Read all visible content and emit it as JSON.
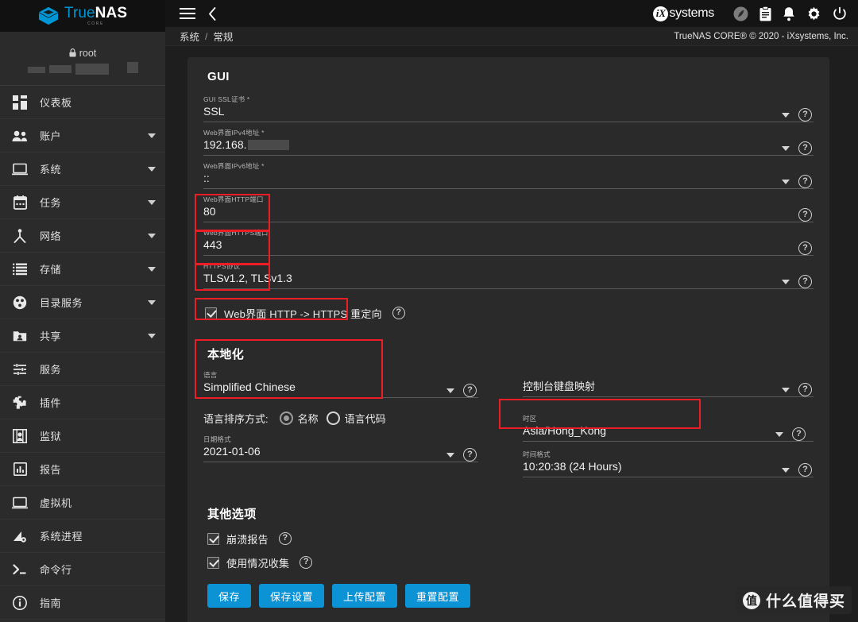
{
  "brand": {
    "name_blue": "True",
    "name_white": "NAS",
    "sub": "CORE"
  },
  "sidebar": {
    "user": {
      "name": "root",
      "lock_icon": "lock-icon"
    },
    "items": [
      {
        "label": "仪表板",
        "icon": "dashboard-icon",
        "expandable": false
      },
      {
        "label": "账户",
        "icon": "accounts-icon",
        "expandable": true
      },
      {
        "label": "系统",
        "icon": "system-icon",
        "expandable": true
      },
      {
        "label": "任务",
        "icon": "tasks-calendar-icon",
        "expandable": true
      },
      {
        "label": "网络",
        "icon": "network-icon",
        "expandable": true
      },
      {
        "label": "存储",
        "icon": "storage-icon",
        "expandable": true
      },
      {
        "label": "目录服务",
        "icon": "directory-services-icon",
        "expandable": true
      },
      {
        "label": "共享",
        "icon": "sharing-icon",
        "expandable": true
      },
      {
        "label": "服务",
        "icon": "services-sliders-icon",
        "expandable": false
      },
      {
        "label": "插件",
        "icon": "plugins-puzzle-icon",
        "expandable": false
      },
      {
        "label": "监狱",
        "icon": "jails-icon",
        "expandable": false
      },
      {
        "label": "报告",
        "icon": "reporting-chart-icon",
        "expandable": false
      },
      {
        "label": "虚拟机",
        "icon": "virtual-machines-icon",
        "expandable": false
      },
      {
        "label": "系统进程",
        "icon": "system-processes-icon",
        "expandable": false
      },
      {
        "label": "命令行",
        "icon": "shell-prompt-icon",
        "expandable": false
      },
      {
        "label": "指南",
        "icon": "guide-info-icon",
        "expandable": false
      }
    ]
  },
  "topbar": {
    "menu_icon": "hamburger-menu-icon",
    "back_icon": "chevron-left-icon",
    "ix_badge": "iX",
    "ix_word": "systems",
    "icons": [
      {
        "name": "resilver-status-icon"
      },
      {
        "name": "task-manager-clipboard-icon"
      },
      {
        "name": "alerts-bell-icon"
      },
      {
        "name": "settings-gear-icon"
      },
      {
        "name": "power-icon"
      }
    ]
  },
  "breadcrumb": {
    "parent": "系统",
    "separator": "/",
    "current": "常规"
  },
  "copyright": "TrueNAS CORE® © 2020 - iXsystems, Inc.",
  "gui": {
    "title": "GUI",
    "fields": [
      {
        "label": "GUI SSL证书 *",
        "value": "SSL",
        "dropdown": true,
        "help": true
      },
      {
        "label": "Web界面IPv4地址 *",
        "value": "192.168.",
        "redacted": true,
        "dropdown": true,
        "help": true
      },
      {
        "label": "Web界面IPv6地址 *",
        "value": "::",
        "dropdown": true,
        "help": true
      },
      {
        "label": "Web界面HTTP端口",
        "value": "80",
        "dropdown": false,
        "help": true
      },
      {
        "label": "Web界面HTTPS端口",
        "value": "443",
        "dropdown": false,
        "help": true
      },
      {
        "label": "HTTPS协议",
        "value": "TLSv1.2, TLSv1.3",
        "dropdown": true,
        "help": true
      }
    ],
    "redirect_checkbox": {
      "label": "Web界面 HTTP -> HTTPS 重定向",
      "checked": true,
      "help": true
    }
  },
  "localization": {
    "title": "本地化",
    "language": {
      "label": "语言",
      "value": "Simplified Chinese"
    },
    "keyboard_map": {
      "label": "控制台键盘映射",
      "value": ""
    },
    "sort_row": {
      "label": "语言排序方式:",
      "options": [
        {
          "text": "名称",
          "selected": true
        },
        {
          "text": "语言代码",
          "selected": false
        }
      ]
    },
    "timezone": {
      "label": "时区",
      "value": "Asia/Hong_Kong"
    },
    "date_format": {
      "label": "日期格式",
      "value": "2021-01-06"
    },
    "time_format": {
      "label": "时间格式",
      "value": "10:20:38 (24 Hours)"
    }
  },
  "other_options": {
    "title": "其他选项",
    "items": [
      {
        "label": "崩溃报告",
        "checked": true
      },
      {
        "label": "使用情况收集",
        "checked": true
      }
    ]
  },
  "buttons": [
    {
      "label": "保存"
    },
    {
      "label": "保存设置"
    },
    {
      "label": "上传配置"
    },
    {
      "label": "重置配置"
    }
  ],
  "watermark": {
    "badge": "值",
    "text": "什么值得买"
  },
  "colors": {
    "accent": "#0b93d5",
    "annotation": "#ee1c25",
    "brand_blue": "#0095d5",
    "panel": "#2a2a2a",
    "page_bg": "#1e1e1e"
  }
}
